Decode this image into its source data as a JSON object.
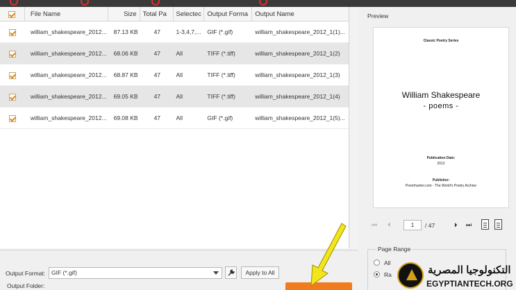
{
  "table": {
    "headers": [
      "File Name",
      "Size",
      "Total Pa",
      "Selectec",
      "Output Forma",
      "Output Name"
    ],
    "rows": [
      {
        "file": "william_shakespeare_2012...",
        "size": "87.13 KB",
        "pages": "47",
        "selected": "1-3,4,7,...",
        "format": "GIF (*.gif)",
        "output": "william_shakespeare_2012_1(1)...",
        "checked": true
      },
      {
        "file": "william_shakespeare_2012...",
        "size": "68.06 KB",
        "pages": "47",
        "selected": "All",
        "format": "TIFF (*.tiff)",
        "output": "william_shakespeare_2012_1(2)",
        "checked": true
      },
      {
        "file": "william_shakespeare_2012...",
        "size": "68.87 KB",
        "pages": "47",
        "selected": "All",
        "format": "TIFF (*.tiff)",
        "output": "william_shakespeare_2012_1(3)",
        "checked": true
      },
      {
        "file": "william_shakespeare_2012...",
        "size": "69.05 KB",
        "pages": "47",
        "selected": "All",
        "format": "TIFF (*.tiff)",
        "output": "william_shakespeare_2012_1(4)",
        "checked": true
      },
      {
        "file": "william_shakespeare_2012...",
        "size": "69.08 KB",
        "pages": "47",
        "selected": "All",
        "format": "GIF (*.gif)",
        "output": "william_shakespeare_2012_1(5)...",
        "checked": true
      }
    ]
  },
  "bottom": {
    "output_format_label": "Output Format:",
    "output_format_value": "GIF (*.gif)",
    "apply_label": "Apply to All",
    "output_folder_label": "Output Folder:"
  },
  "preview": {
    "title": "Preview",
    "series": "Classic Poetry Series",
    "book_title": "William Shakespeare",
    "book_subtitle": "- poems -",
    "pub_date_label": "Publication Date:",
    "pub_year": "2012",
    "publisher_label": "Publisher:",
    "publisher_name": "Poemhunter.com - The World's Poetry Archive",
    "current_page": "1",
    "total_pages": "/ 47"
  },
  "page_range": {
    "title": "Page Range",
    "option_all": "All",
    "option_range": "Ra"
  },
  "watermark": {
    "arabic": "التكنولوجيا المصرية",
    "english": "EGYPTIANTECH.ORG"
  },
  "colors": {
    "accent": "#f07c1f",
    "check": "#d88a1a",
    "arrow": "#f2e51a"
  }
}
